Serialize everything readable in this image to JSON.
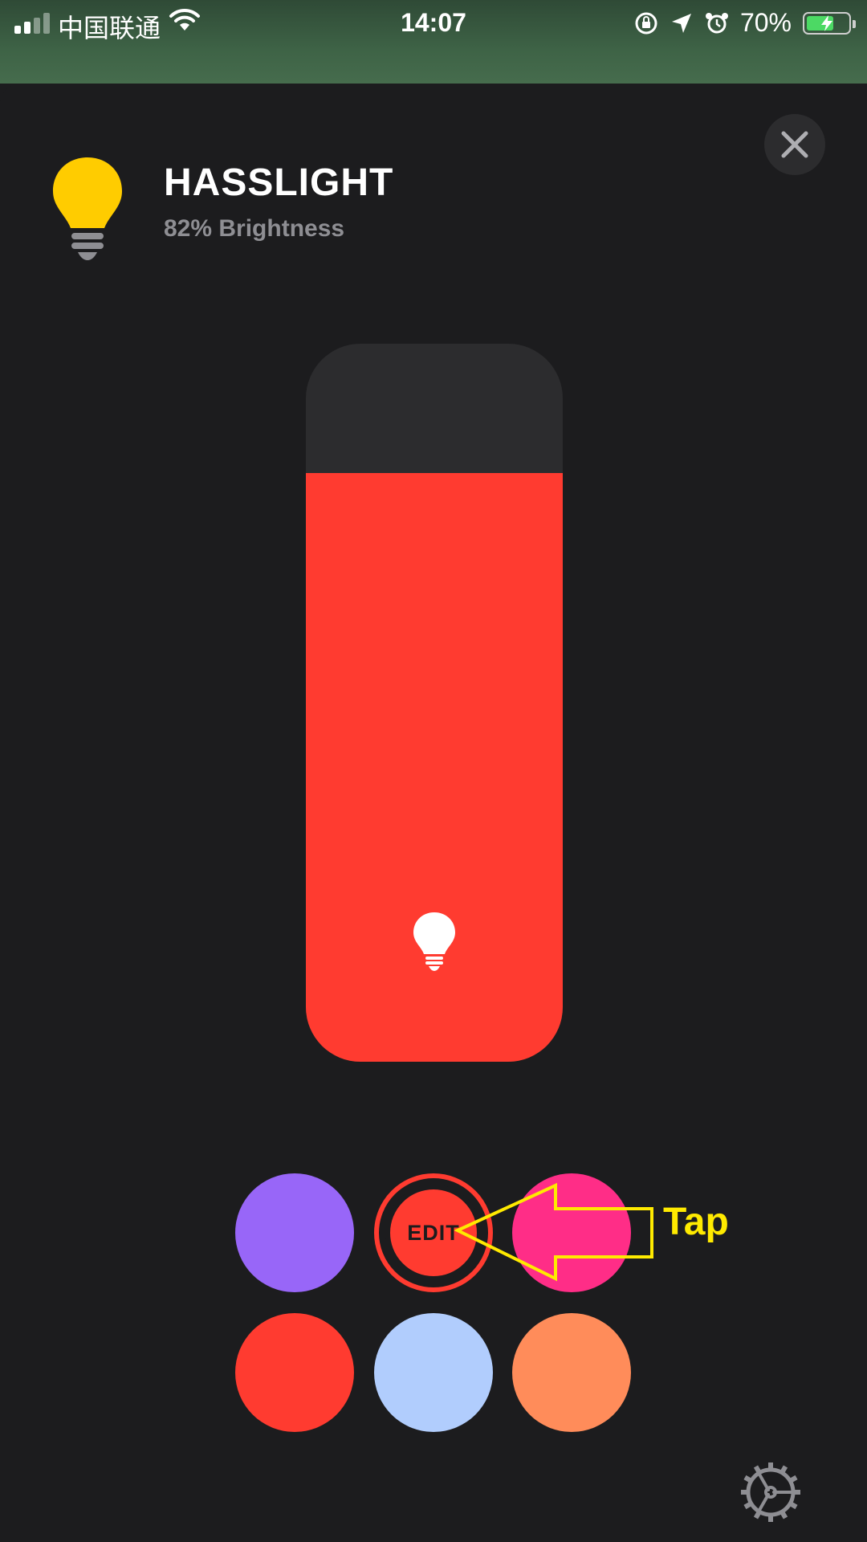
{
  "status_bar": {
    "carrier": "中国联通",
    "time": "14:07",
    "battery_percent": "70%",
    "battery_level": 0.7,
    "signal_bars": 2,
    "icons": [
      "signal-icon",
      "wifi-icon",
      "orientation-lock-icon",
      "location-icon",
      "alarm-icon",
      "battery-icon"
    ]
  },
  "header": {
    "title": "HASSLIGHT",
    "subtitle": "82% Brightness",
    "icon": "lightbulb-icon",
    "icon_color": "#ffcc00"
  },
  "brightness_slider": {
    "value": 0.82,
    "fill_color": "#ff3b30",
    "track_color": "#2c2c2e",
    "icon": "lightbulb-icon"
  },
  "color_presets": {
    "edit_label": "EDIT",
    "swatches": [
      {
        "color": "#9866f8",
        "name": "purple"
      },
      {
        "color": "#ff3b30",
        "name": "red",
        "selected": true
      },
      {
        "color": "#ff2d87",
        "name": "pink"
      },
      {
        "color": "#ff3b30",
        "name": "red"
      },
      {
        "color": "#b1cdfd",
        "name": "light-blue"
      },
      {
        "color": "#ff8c5a",
        "name": "orange"
      }
    ]
  },
  "annotation": {
    "text": "Tap",
    "color": "#ffea00"
  },
  "footer": {
    "settings_icon": "gear-icon"
  },
  "close_icon": "close-icon"
}
